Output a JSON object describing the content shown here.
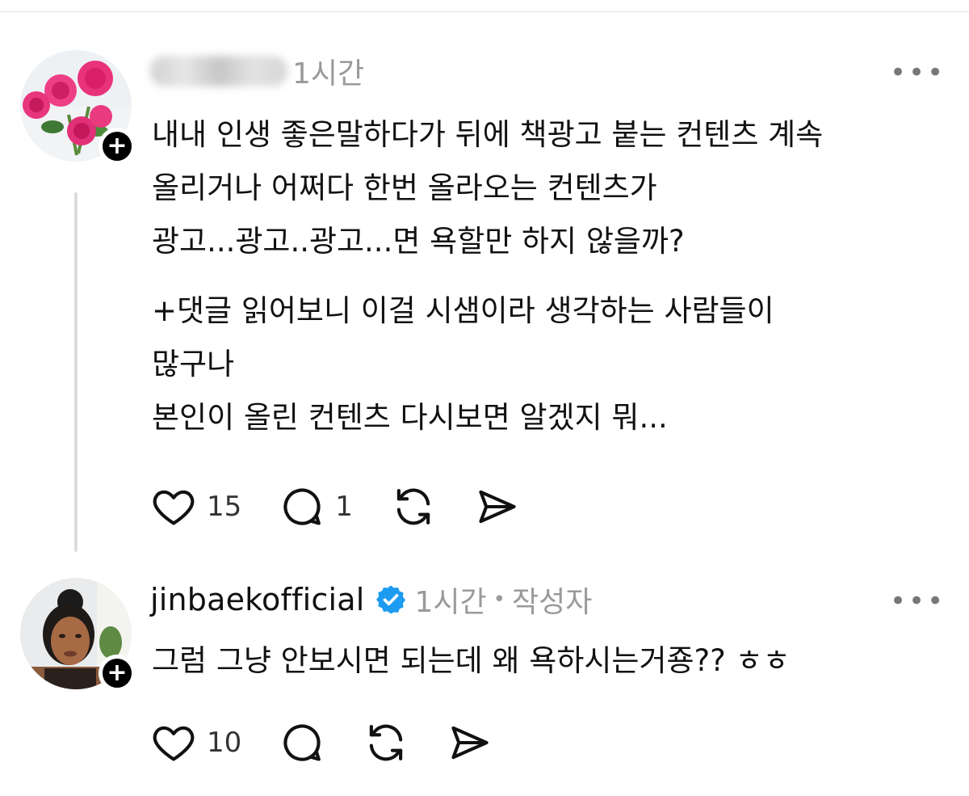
{
  "posts": [
    {
      "username_visible": "",
      "time": "1시간",
      "more_label": "•••",
      "follow_label": "+",
      "lines": [
        "내내 인생 좋은말하다가 뒤에 책광고 붙는 컨텐츠 계속",
        "올리거나 어쩌다 한번 올라오는 컨텐츠가",
        "광고...광고..광고...면 욕할만 하지 않을까?",
        "",
        "+댓글 읽어보니 이걸 시샘이라 생각하는 사람들이",
        "많구나",
        "본인이 올린 컨텐츠 다시보면 알겠지 뭐..."
      ],
      "likes": "15",
      "replies": "1"
    },
    {
      "username": "jinbaekofficial",
      "verified_icon": "verified-badge-icon",
      "time": "1시간",
      "separator": "•",
      "author_tag": "작성자",
      "more_label": "•••",
      "follow_label": "+",
      "lines": [
        "그럼 그냥 안보시면 되는데 왜 욕하시는거죵?? ㅎㅎ"
      ],
      "likes": "10",
      "replies": ""
    }
  ],
  "icons": {
    "like": "heart-icon",
    "reply": "comment-icon",
    "repost": "repost-icon",
    "share": "send-icon"
  },
  "colors": {
    "verified": "#1d9bf0",
    "muted": "#9a9a9a"
  }
}
